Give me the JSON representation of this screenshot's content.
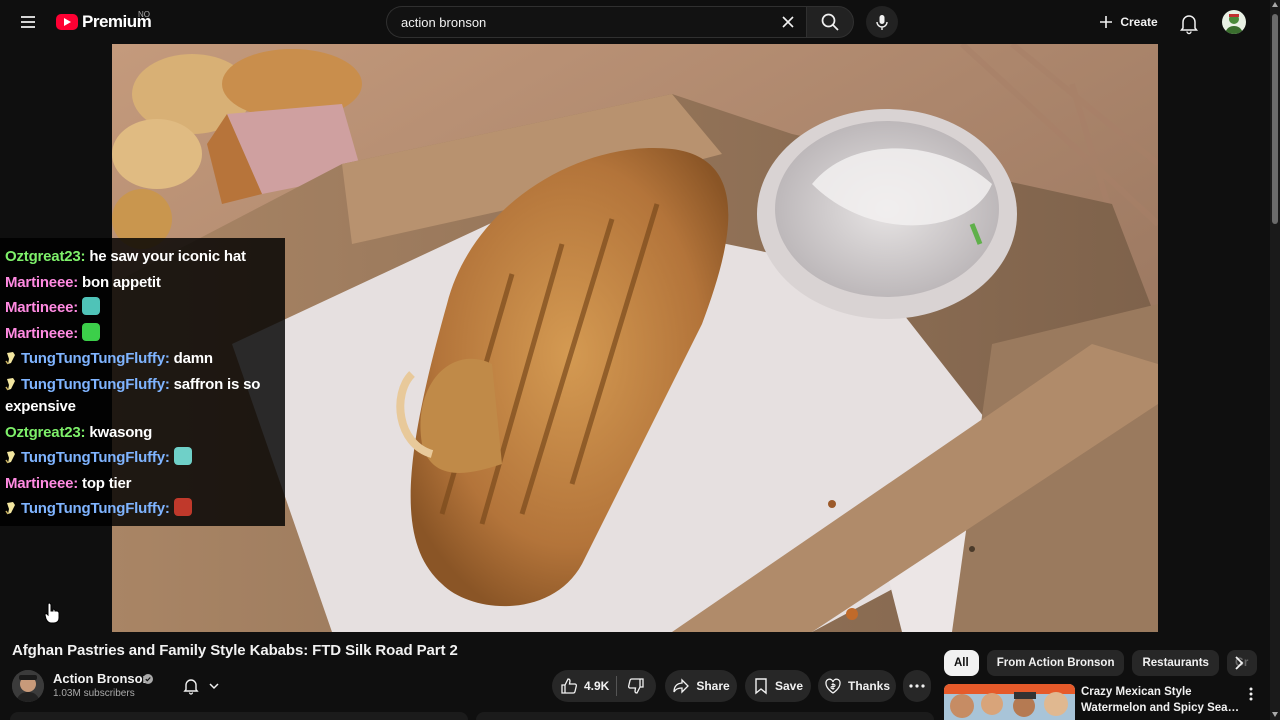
{
  "topbar": {
    "logo_text": "Premium",
    "region_code": "NO",
    "search_value": "action bronson",
    "create_label": "Create",
    "icons": [
      "menu-icon",
      "youtube-logo-icon",
      "close-icon",
      "search-icon",
      "mic-icon",
      "plus-icon",
      "bell-icon",
      "avatar"
    ]
  },
  "chat": {
    "messages": [
      {
        "user": "Oztgreat23:",
        "text": "he saw your iconic hat",
        "color": "#7ef06a",
        "badge": false,
        "emote": null
      },
      {
        "user": "Martineee:",
        "text": "bon appetit",
        "color": "#ff8ae1",
        "badge": false,
        "emote": null
      },
      {
        "user": "Martineee:",
        "text": "",
        "color": "#ff8ae1",
        "badge": false,
        "emote": "emote-cyan"
      },
      {
        "user": "Martineee:",
        "text": "",
        "color": "#ff8ae1",
        "badge": false,
        "emote": "emote-green"
      },
      {
        "user": "TungTungTungFluffy:",
        "text": "damn",
        "color": "#7fb4ff",
        "badge": true,
        "emote": null
      },
      {
        "user": "TungTungTungFluffy:",
        "text": "saffron is so expensive",
        "color": "#7fb4ff",
        "badge": true,
        "emote": null
      },
      {
        "user": "Oztgreat23:",
        "text": "kwasong",
        "color": "#7ef06a",
        "badge": false,
        "emote": null
      },
      {
        "user": "TungTungTungFluffy:",
        "text": "",
        "color": "#7fb4ff",
        "badge": true,
        "emote": "emote-teal"
      },
      {
        "user": "Martineee:",
        "text": "top tier",
        "color": "#ff8ae1",
        "badge": false,
        "emote": null
      },
      {
        "user": "TungTungTungFluffy:",
        "text": "",
        "color": "#7fb4ff",
        "badge": true,
        "emote": "emote-red"
      }
    ]
  },
  "video": {
    "title": "Afghan Pastries and Family Style Kababs: FTD Silk Road Part 2",
    "channel_name": "Action Bronson",
    "subscribers": "1.03M subscribers",
    "likes": "4.9K",
    "share_label": "Share",
    "save_label": "Save",
    "thanks_label": "Thanks"
  },
  "sidebar": {
    "chips": [
      "All",
      "From Action Bronson",
      "Restaurants",
      "Gr"
    ],
    "active_chip": "All",
    "recommendation": {
      "title_line1": "Crazy Mexican Style",
      "title_line2": "Watermelon and Spicy Seafoo..."
    }
  },
  "colors": {
    "background": "#0f0f0f",
    "brand_red": "#ff0033",
    "chat_green": "#7ef06a",
    "chat_pink": "#ff8ae1",
    "chat_blue": "#7fb4ff"
  }
}
